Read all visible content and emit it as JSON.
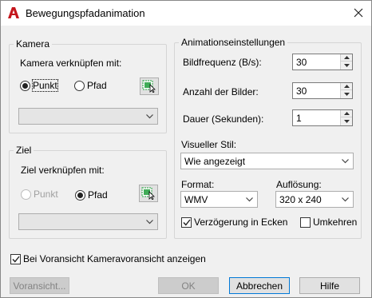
{
  "window": {
    "title": "Bewegungspfadanimation"
  },
  "camera": {
    "group_label": "Kamera",
    "link_label": "Kamera verknüpfen mit:",
    "radio_point": "Punkt",
    "radio_path": "Pfad",
    "selected": "Punkt",
    "select_value": ""
  },
  "target": {
    "group_label": "Ziel",
    "link_label": "Ziel verknüpfen mit:",
    "radio_point": "Punkt",
    "radio_path": "Pfad",
    "selected": "Pfad",
    "select_value": ""
  },
  "animation": {
    "group_label": "Animationseinstellungen",
    "framerate_label": "Bildfrequenz (B/s):",
    "framerate_value": "30",
    "frames_label": "Anzahl der Bilder:",
    "frames_value": "30",
    "duration_label": "Dauer (Sekunden):",
    "duration_value": "1",
    "visual_style_label": "Visueller Stil:",
    "visual_style_value": "Wie angezeigt",
    "format_label": "Format:",
    "format_value": "WMV",
    "resolution_label": "Auflösung:",
    "resolution_value": "320 x 240",
    "corner_deceleration_label": "Verzögerung in Ecken",
    "corner_deceleration_checked": true,
    "reverse_label": "Umkehren",
    "reverse_checked": false
  },
  "preview_checkbox": {
    "label": "Bei Voransicht Kameravoransicht anzeigen",
    "checked": true
  },
  "buttons": {
    "preview": "Voransicht...",
    "ok": "OK",
    "cancel": "Abbrechen",
    "help": "Hilfe"
  },
  "icons": {
    "app": "autocad-logo-icon",
    "close": "close-icon",
    "pick": "pick-point-icon",
    "dropdown": "chevron-down-icon",
    "spin_up": "spin-up-icon",
    "spin_down": "spin-down-icon"
  },
  "colors": {
    "accent": "#0078d7",
    "app_red": "#c4161c",
    "pick_green": "#1e9e3a"
  }
}
